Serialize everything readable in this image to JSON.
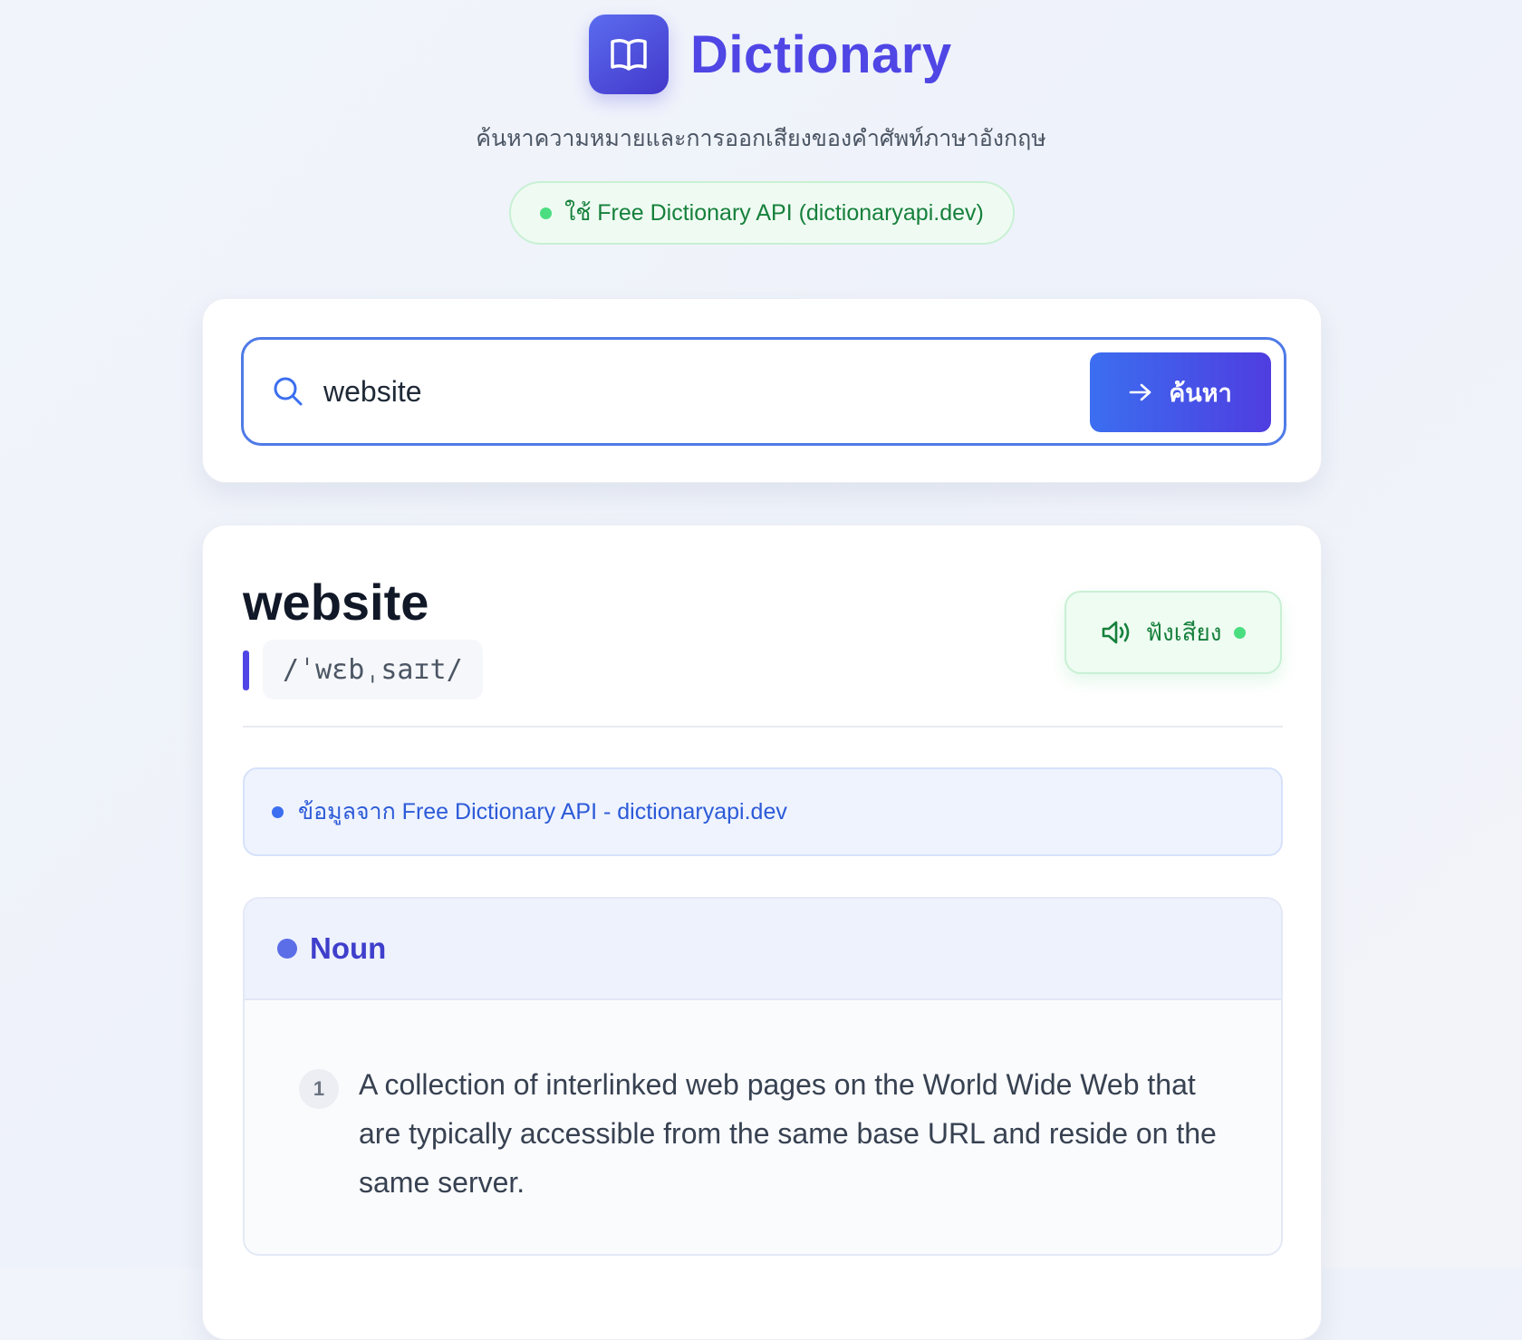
{
  "header": {
    "app_title": "Dictionary",
    "logo_icon": "open-book-icon",
    "subtitle": "ค้นหาความหมายและการออกเสียงของคำศัพท์ภาษาอังกฤษ",
    "api_badge": "ใช้ Free Dictionary API (dictionaryapi.dev)"
  },
  "search": {
    "icon": "search-icon",
    "value": "website",
    "button_label": "ค้นหา",
    "button_icon": "arrow-right-icon"
  },
  "result": {
    "word": "website",
    "phonetic": "/ˈwɛbˌsaɪt/",
    "listen_label": "ฟังเสียง",
    "listen_icon": "speaker-icon",
    "source_note": "ข้อมูลจาก Free Dictionary API - dictionaryapi.dev",
    "meanings": [
      {
        "part_of_speech": "Noun",
        "definitions": [
          {
            "number": "1",
            "text": "A collection of interlinked web pages on the World Wide Web that are typically accessible from the same base URL and reside on the same server."
          }
        ]
      }
    ]
  },
  "colors": {
    "brand": "#4f46e5",
    "success": "#16803c",
    "info": "#2c5ad8"
  }
}
